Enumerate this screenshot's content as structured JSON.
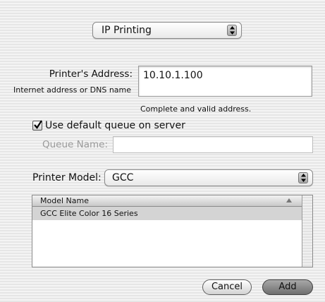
{
  "protocol": {
    "selected": "IP Printing"
  },
  "address": {
    "label": "Printer's Address:",
    "sublabel": "Internet address or DNS name",
    "value": "10.10.1.100",
    "status": "Complete and valid address."
  },
  "queue": {
    "checkbox_label": "Use default queue on server",
    "checked": true,
    "name_label": "Queue Name:",
    "name_value": ""
  },
  "model": {
    "label": "Printer Model:",
    "selected": "GCC",
    "column_header": "Model Name",
    "rows": [
      {
        "name": "GCC Elite Color 16 Series",
        "selected": true
      }
    ]
  },
  "buttons": {
    "cancel": "Cancel",
    "add": "Add"
  }
}
